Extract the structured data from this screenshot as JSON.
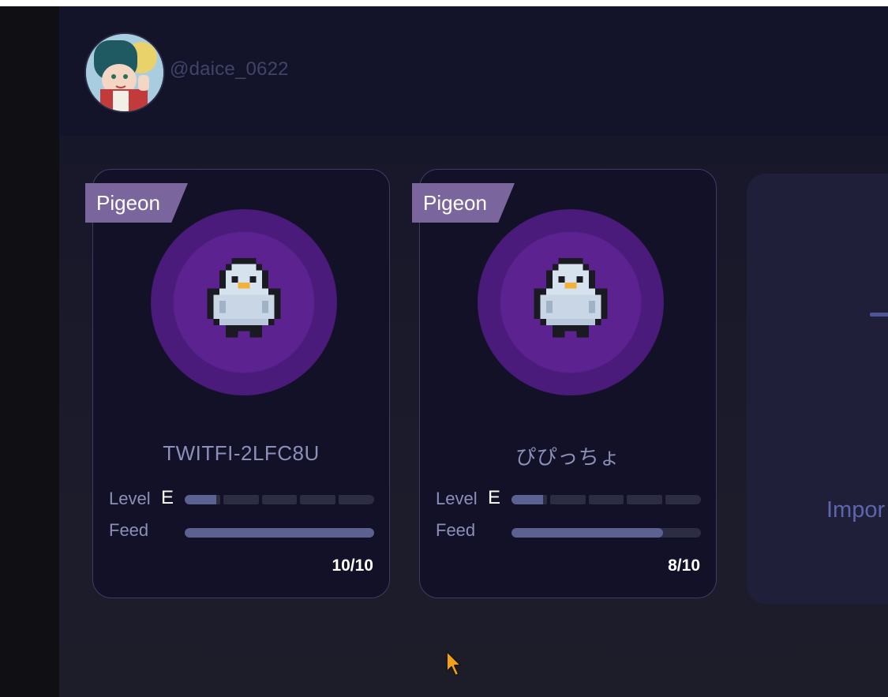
{
  "header": {
    "username": "@daice_0622",
    "avatar_icon": "user-avatar"
  },
  "cards": [
    {
      "badge": "Pigeon",
      "name": "TWITFI-2LFC8U",
      "level_label": "Level",
      "level_grade": "E",
      "level_progress": 0.18,
      "feed_label": "Feed",
      "feed_fraction": 1.0,
      "feed_text": "10/10",
      "icon": "pigeon-pixel-icon"
    },
    {
      "badge": "Pigeon",
      "name": "ぴぴっちょ",
      "level_label": "Level",
      "level_grade": "E",
      "level_progress": 0.18,
      "feed_label": "Feed",
      "feed_fraction": 0.8,
      "feed_text": "8/10",
      "icon": "pigeon-pixel-icon"
    }
  ],
  "import_card": {
    "label": "Impor",
    "icon": "plus-icon"
  },
  "colors": {
    "accent": "#7a669c",
    "orb": "#5b2290",
    "bar_fill": "#5b6291",
    "bar_track": "#2c2c42",
    "card_bg": "#131128"
  }
}
